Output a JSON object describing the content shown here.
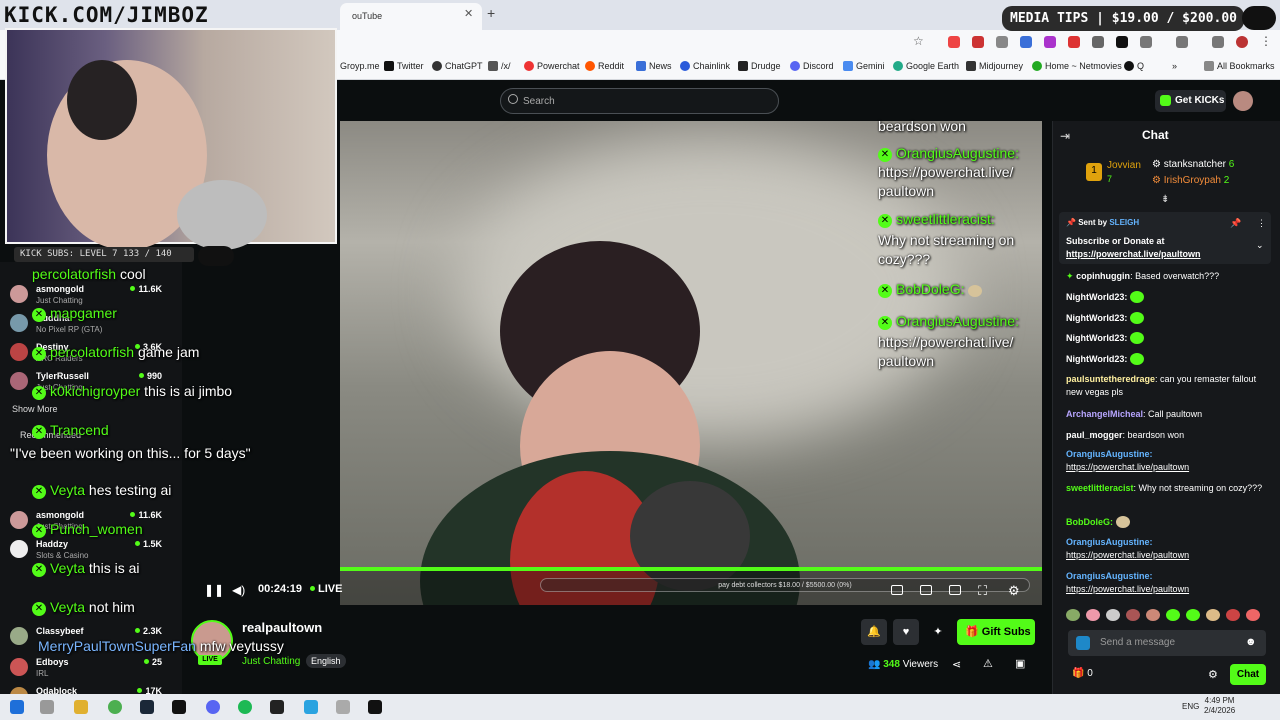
{
  "browser": {
    "active_tab_title": "ouTube",
    "bookmarks": [
      "Groyp.me",
      "Twitter",
      "ChatGPT",
      "/x/",
      "Powerchat",
      "Reddit",
      "News",
      "Chainlink",
      "Drudge",
      "Discord",
      "Gemini",
      "Google Earth",
      "Midjourney",
      "Home ~ Netmovies",
      "Q"
    ],
    "all_bookmarks": "All Bookmarks"
  },
  "overlay": {
    "channel_url": "KICK.COM/JIMBOZ",
    "sub_bar": "KICK SUBS: LEVEL 7 133 / 140",
    "media_tips": "MEDIA TIPS | $19.00 / $200.00"
  },
  "header": {
    "search_placeholder": "Search",
    "get_kicks": "Get KICKs"
  },
  "video_chat_overlay": [
    {
      "user": "",
      "text": "beardson won"
    },
    {
      "user": "OrangiusAugustine:",
      "text": "https://powerchat.live/"
    },
    {
      "user": "",
      "text": "paultown"
    },
    {
      "user": "sweetlittleracist:",
      "text": ""
    },
    {
      "user": "",
      "text": "Why not streaming on"
    },
    {
      "user": "",
      "text": "cozy???"
    },
    {
      "user": "BobDoleG:",
      "text": ""
    },
    {
      "user": "OrangiusAugustine:",
      "text": ""
    },
    {
      "user": "",
      "text": "https://powerchat.live/"
    },
    {
      "user": "",
      "text": "paultown"
    }
  ],
  "left_overlay_chat": [
    {
      "user": "percolatorfish",
      "text": "cool"
    },
    {
      "user": "mapgamer",
      "text": ""
    },
    {
      "user": "percolatorfish",
      "text": "game jam"
    },
    {
      "user": "k0kichigroyper",
      "text": "this is ai jimbo"
    },
    {
      "user": "Trancend",
      "text": ""
    },
    {
      "user": "",
      "text": "\"I've been working on this... for 5 days\""
    },
    {
      "user": "Veyta",
      "text": "hes testing ai"
    },
    {
      "user": "Punch_women",
      "text": ""
    },
    {
      "user": "Veyta",
      "text": "this is ai"
    },
    {
      "user": "Veyta",
      "text": "not him"
    },
    {
      "user": "MerryPaulTownSuperFan",
      "text": "mfw veytussy"
    }
  ],
  "player": {
    "time": "00:24:19",
    "live": "LIVE",
    "goal": "pay debt collectors $18.00 / $5500.00 (0%)",
    "progress": 1.0
  },
  "sidebar": {
    "channels": [
      {
        "name": "asmongold",
        "category": "Just Chatting",
        "viewers": "11.6K"
      },
      {
        "name": "Buddha",
        "category": "No Pixel RP (GTA)",
        "viewers": ""
      },
      {
        "name": "Destiny",
        "category": "ARC Raiders",
        "viewers": "3.6K"
      },
      {
        "name": "TylerRussell",
        "category": "Just Chatting",
        "viewers": "990"
      },
      {
        "name": "asmongold",
        "category": "Just Chatting",
        "viewers": "11.6K"
      },
      {
        "name": "Haddzy",
        "category": "Slots & Casino",
        "viewers": "1.5K"
      },
      {
        "name": "Classybeef",
        "category": "",
        "viewers": "2.3K"
      },
      {
        "name": "Edboys",
        "category": "IRL",
        "viewers": "25"
      },
      {
        "name": "Odablock",
        "category": "",
        "viewers": "17K"
      }
    ],
    "show_more": "Show More",
    "recommended": "Recommended"
  },
  "stream": {
    "streamer": "realpaultown",
    "category": "Just Chatting",
    "language": "English",
    "viewers_count": "348",
    "viewers_label": "Viewers",
    "gift_subs": "Gift Subs",
    "live_badge": "LIVE"
  },
  "chat": {
    "title": "Chat",
    "leaderboard": [
      {
        "user": "Jovvian",
        "count": "7"
      },
      {
        "user": "stanksnatcher",
        "count": "6"
      },
      {
        "user": "IrishGroypah",
        "count": "2"
      }
    ],
    "pinned_by_label": "Sent by",
    "pinned_by": "SLEIGH",
    "pinned_text": "Subscribe or Donate at",
    "pinned_link": "https://powerchat.live/paultown",
    "messages": [
      {
        "user": "copinhuggin",
        "text": "Based overwatch???"
      },
      {
        "user": "NightWorld23:",
        "text": ""
      },
      {
        "user": "NightWorld23:",
        "text": ""
      },
      {
        "user": "NightWorld23:",
        "text": ""
      },
      {
        "user": "NightWorld23:",
        "text": ""
      },
      {
        "user": "paulsuntetheredrage",
        "text": "can you remaster fallout new vegas pls"
      },
      {
        "user": "ArchangelMicheal",
        "text": "Call paultown"
      },
      {
        "user": "paul_mogger",
        "text": "beardson won"
      },
      {
        "user": "OrangiusAugustine:",
        "text": "https://powerchat.live/paultown"
      },
      {
        "user": "sweetlittleracist",
        "text": "Why not streaming on cozy???"
      },
      {
        "user": "BobDoleG:",
        "text": ""
      },
      {
        "user": "OrangiusAugustine:",
        "text": "https://powerchat.live/paultown"
      },
      {
        "user": "OrangiusAugustine:",
        "text": "https://powerchat.live/paultown"
      }
    ],
    "input_placeholder": "Send a message",
    "kicks_count": "0",
    "send_label": "Chat"
  },
  "taskbar": {
    "language": "ENG",
    "time": "4:49 PM",
    "date": "2/4/2026"
  }
}
